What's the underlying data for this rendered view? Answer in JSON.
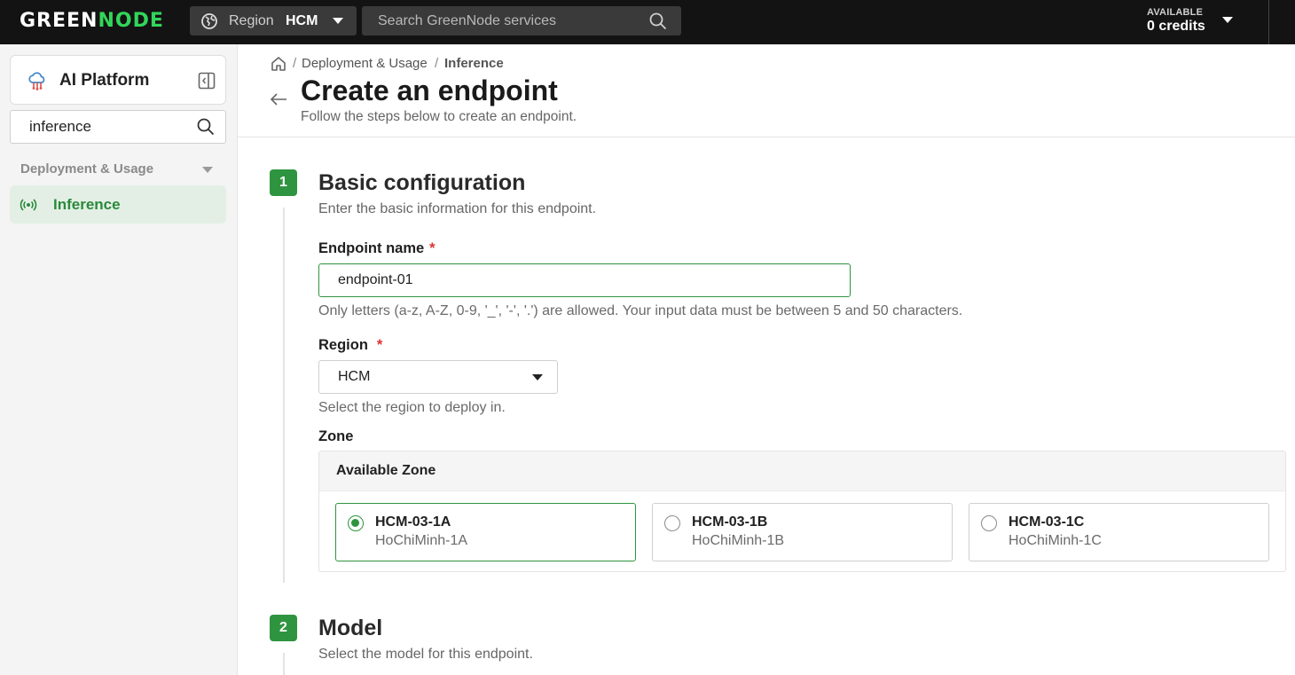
{
  "topbar": {
    "logo_a": "GREEN",
    "logo_b": "NODE",
    "region_label": "Region",
    "region_value": "HCM",
    "search_placeholder": "Search GreenNode services",
    "credits_caption": "AVAILABLE",
    "credits_value": "0 credits"
  },
  "sidebar": {
    "app_title": "AI Platform",
    "search_value": "inference",
    "section": "Deployment & Usage",
    "items": [
      {
        "label": "Inference",
        "active": true
      }
    ]
  },
  "breadcrumb": [
    "Deployment & Usage",
    "Inference"
  ],
  "page": {
    "title": "Create an endpoint",
    "subtitle": "Follow the steps below to create an endpoint."
  },
  "steps": [
    {
      "number": "1",
      "title": "Basic configuration",
      "description": "Enter the basic information for this endpoint."
    },
    {
      "number": "2",
      "title": "Model",
      "description": "Select the model for this endpoint."
    }
  ],
  "form": {
    "endpoint_name": {
      "label": "Endpoint name",
      "required_mark": "*",
      "value": "endpoint-01",
      "hint": "Only letters (a-z, A-Z, 0-9, '_', '-', '.') are allowed. Your input data must be between 5 and 50 characters."
    },
    "region": {
      "label": "Region",
      "required_mark": "*",
      "value": "HCM",
      "hint": "Select the region to deploy in."
    },
    "zone": {
      "label": "Zone",
      "panel_title": "Available Zone",
      "options": [
        {
          "name": "HCM-03-1A",
          "sub": "HoChiMinh-1A",
          "selected": true
        },
        {
          "name": "HCM-03-1B",
          "sub": "HoChiMinh-1B",
          "selected": false
        },
        {
          "name": "HCM-03-1C",
          "sub": "HoChiMinh-1C",
          "selected": false
        }
      ]
    }
  },
  "colors": {
    "brand_green": "#2f9440",
    "topbar_bg": "#131313",
    "logo_accent": "#32d65a"
  }
}
